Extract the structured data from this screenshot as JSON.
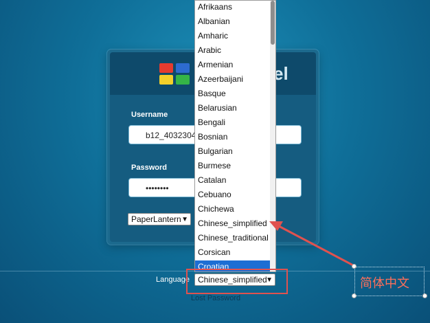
{
  "login": {
    "logo_text": "el",
    "username_label": "Username",
    "username_value": "b12_4032304",
    "password_label": "Password",
    "password_value": "••••••••",
    "theme_selected": "PaperLantern",
    "language_label": "Language",
    "language_selected": "Chinese_simplified",
    "lost_password": "Lost Password"
  },
  "dropdown": {
    "options": [
      "Afrikaans",
      "Albanian",
      "Amharic",
      "Arabic",
      "Armenian",
      "Azeerbaijani",
      "Basque",
      "Belarusian",
      "Bengali",
      "Bosnian",
      "Bulgarian",
      "Burmese",
      "Catalan",
      "Cebuano",
      "Chichewa",
      "Chinese_simplified",
      "Chinese_traditional",
      "Corsican",
      "Croatian"
    ],
    "highlighted": "Croatian"
  },
  "annotation": {
    "text": "简体中文",
    "color": "#ff6f5a",
    "box_color": "#e0524f"
  },
  "colors": {
    "panel": "#1c6a8e",
    "background": "#0f6f99",
    "option_highlight": "#1c6ed4"
  }
}
